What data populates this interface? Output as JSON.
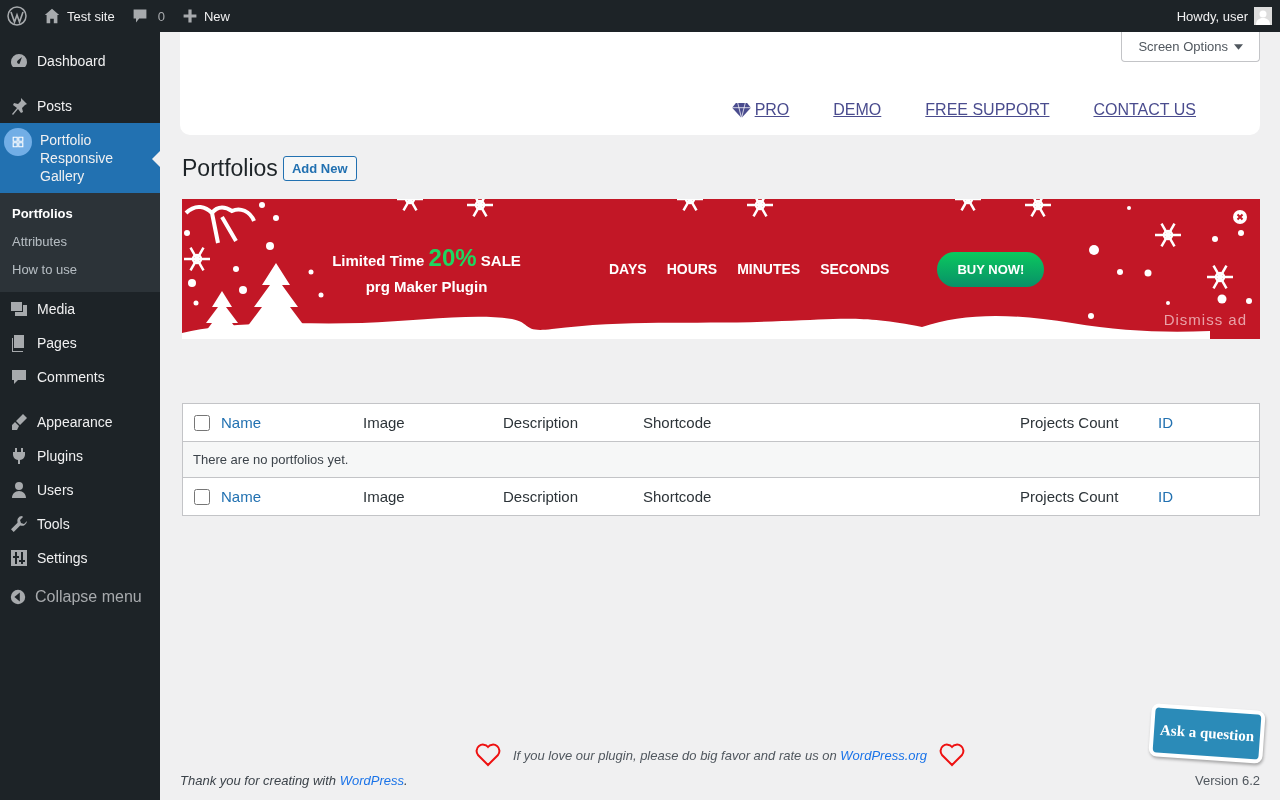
{
  "admin_bar": {
    "site": "Test site",
    "comments": "0",
    "new": "New",
    "greeting": "Howdy, user"
  },
  "sidebar": {
    "groups": [
      [
        {
          "label": "Dashboard",
          "selected": false
        }
      ],
      [
        {
          "label": "Posts",
          "selected": false
        },
        {
          "label": "Portfolio Responsive Gallery",
          "selected": true,
          "submenu": [
            {
              "label": "Portfolios",
              "selected": true
            },
            {
              "label": "Attributes",
              "selected": false
            },
            {
              "label": "How to use",
              "selected": false
            }
          ]
        },
        {
          "label": "Media",
          "selected": false
        },
        {
          "label": "Pages",
          "selected": false
        },
        {
          "label": "Comments",
          "selected": false
        }
      ],
      [
        {
          "label": "Appearance",
          "selected": false
        },
        {
          "label": "Plugins",
          "selected": false
        },
        {
          "label": "Users",
          "selected": false
        },
        {
          "label": "Tools",
          "selected": false
        },
        {
          "label": "Settings",
          "selected": false
        }
      ]
    ],
    "collapse": "Collapse menu"
  },
  "screen_options": "Screen Options",
  "plugin_nav": [
    "PRO",
    "DEMO",
    "FREE SUPPORT",
    "CONTACT US"
  ],
  "page_title": "Portfolios",
  "add_new": "Add New",
  "banner": {
    "line1_before": "Limited Time",
    "highlight": "20%",
    "line1_after": "SALE",
    "line2": "prg Maker Plugin",
    "countdown": [
      "DAYS",
      "HOURS",
      "MINUTES",
      "SECONDS"
    ],
    "cta": "BUY NOW!",
    "dismiss": "Dismiss ad"
  },
  "table": {
    "header": {
      "checked": false,
      "columns": [
        {
          "label": "Name",
          "sortable": true
        },
        {
          "label": "Image",
          "sortable": false
        },
        {
          "label": "Description",
          "sortable": false
        },
        {
          "label": "Shortcode",
          "sortable": false
        },
        {
          "label": "Projects Count",
          "sortable": false
        },
        {
          "label": "ID",
          "sortable": true
        }
      ]
    },
    "empty": "There are no portfolios yet.",
    "footer": {
      "checked": false,
      "columns": [
        {
          "label": "Name",
          "sortable": true
        },
        {
          "label": "Image",
          "sortable": false
        },
        {
          "label": "Description",
          "sortable": false
        },
        {
          "label": "Shortcode",
          "sortable": false
        },
        {
          "label": "Projects Count",
          "sortable": false
        },
        {
          "label": "ID",
          "sortable": true
        }
      ]
    }
  },
  "rate": {
    "before": "If you love our plugin, please do big favor and rate us on",
    "link": "WordPress.org"
  },
  "footer": {
    "before": "Thank you for creating with",
    "link": "WordPress",
    "after": ".",
    "version": "Version 6.2"
  },
  "ask_bubble": "Ask a question"
}
